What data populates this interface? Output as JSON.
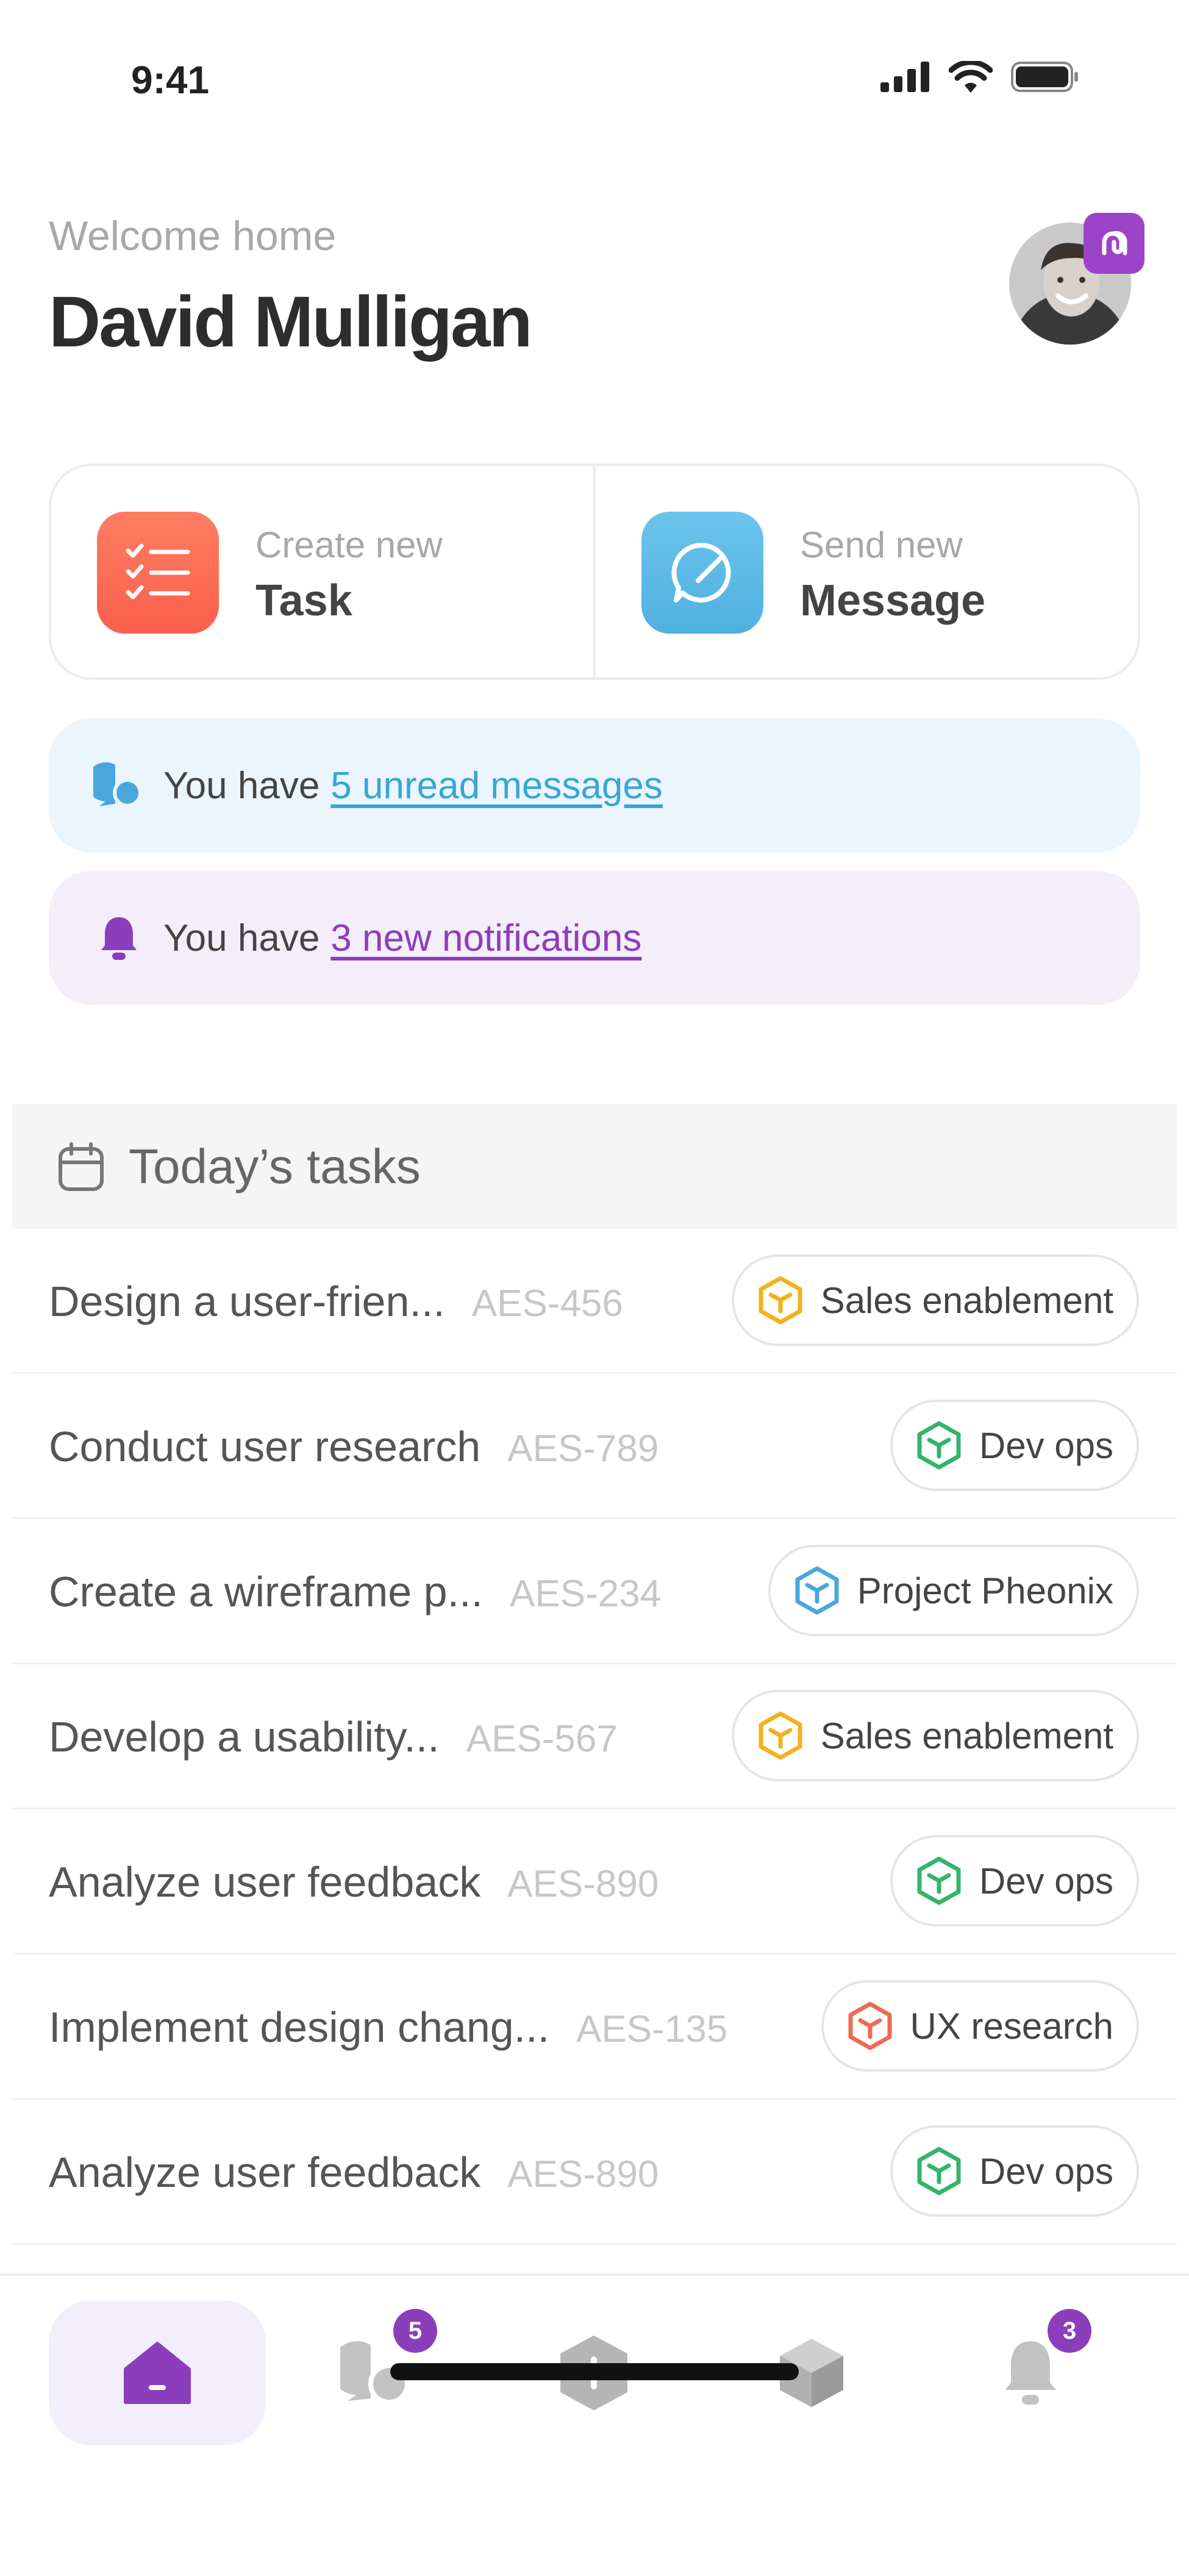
{
  "status_bar": {
    "time": "9:41"
  },
  "header": {
    "welcome": "Welcome home",
    "name": "David Mulligan"
  },
  "quick_actions": {
    "task": {
      "small": "Create new",
      "big": "Task"
    },
    "message": {
      "small": "Send new",
      "big": "Message"
    }
  },
  "banners": {
    "messages": {
      "prefix": "You have",
      "link": "5 unread messages"
    },
    "notifications": {
      "prefix": "You have",
      "link": "3 new notifications"
    }
  },
  "tasks": {
    "title": "Today’s tasks",
    "rows": [
      {
        "name": "Design a user-frien...",
        "id": "AES-456",
        "tag": "Sales enablement",
        "tag_color": "#f2b21b"
      },
      {
        "name": "Conduct user research",
        "id": "AES-789",
        "tag": "Dev ops",
        "tag_color": "#33b46a"
      },
      {
        "name": "Create a wireframe p...",
        "id": "AES-234",
        "tag": "Project Pheonix",
        "tag_color": "#4aa6dc"
      },
      {
        "name": "Develop a usability...",
        "id": "AES-567",
        "tag": "Sales enablement",
        "tag_color": "#f2b21b"
      },
      {
        "name": "Analyze user feedback",
        "id": "AES-890",
        "tag": "Dev ops",
        "tag_color": "#33b46a"
      },
      {
        "name": "Implement design chang...",
        "id": "AES-135",
        "tag": "UX research",
        "tag_color": "#ee6a50"
      },
      {
        "name": "Analyze user feedback",
        "id": "AES-890",
        "tag": "Dev ops",
        "tag_color": "#33b46a"
      }
    ]
  },
  "bottom_nav": {
    "items": [
      {
        "icon": "home-icon",
        "active": true
      },
      {
        "icon": "chat-icon",
        "badge": "5"
      },
      {
        "icon": "add-icon"
      },
      {
        "icon": "cube-icon"
      },
      {
        "icon": "bell-icon",
        "badge": "3"
      }
    ]
  },
  "colors": {
    "accent": "#8c3eba",
    "task_icon": "#fd7159",
    "message_icon": "#58b7e3"
  }
}
